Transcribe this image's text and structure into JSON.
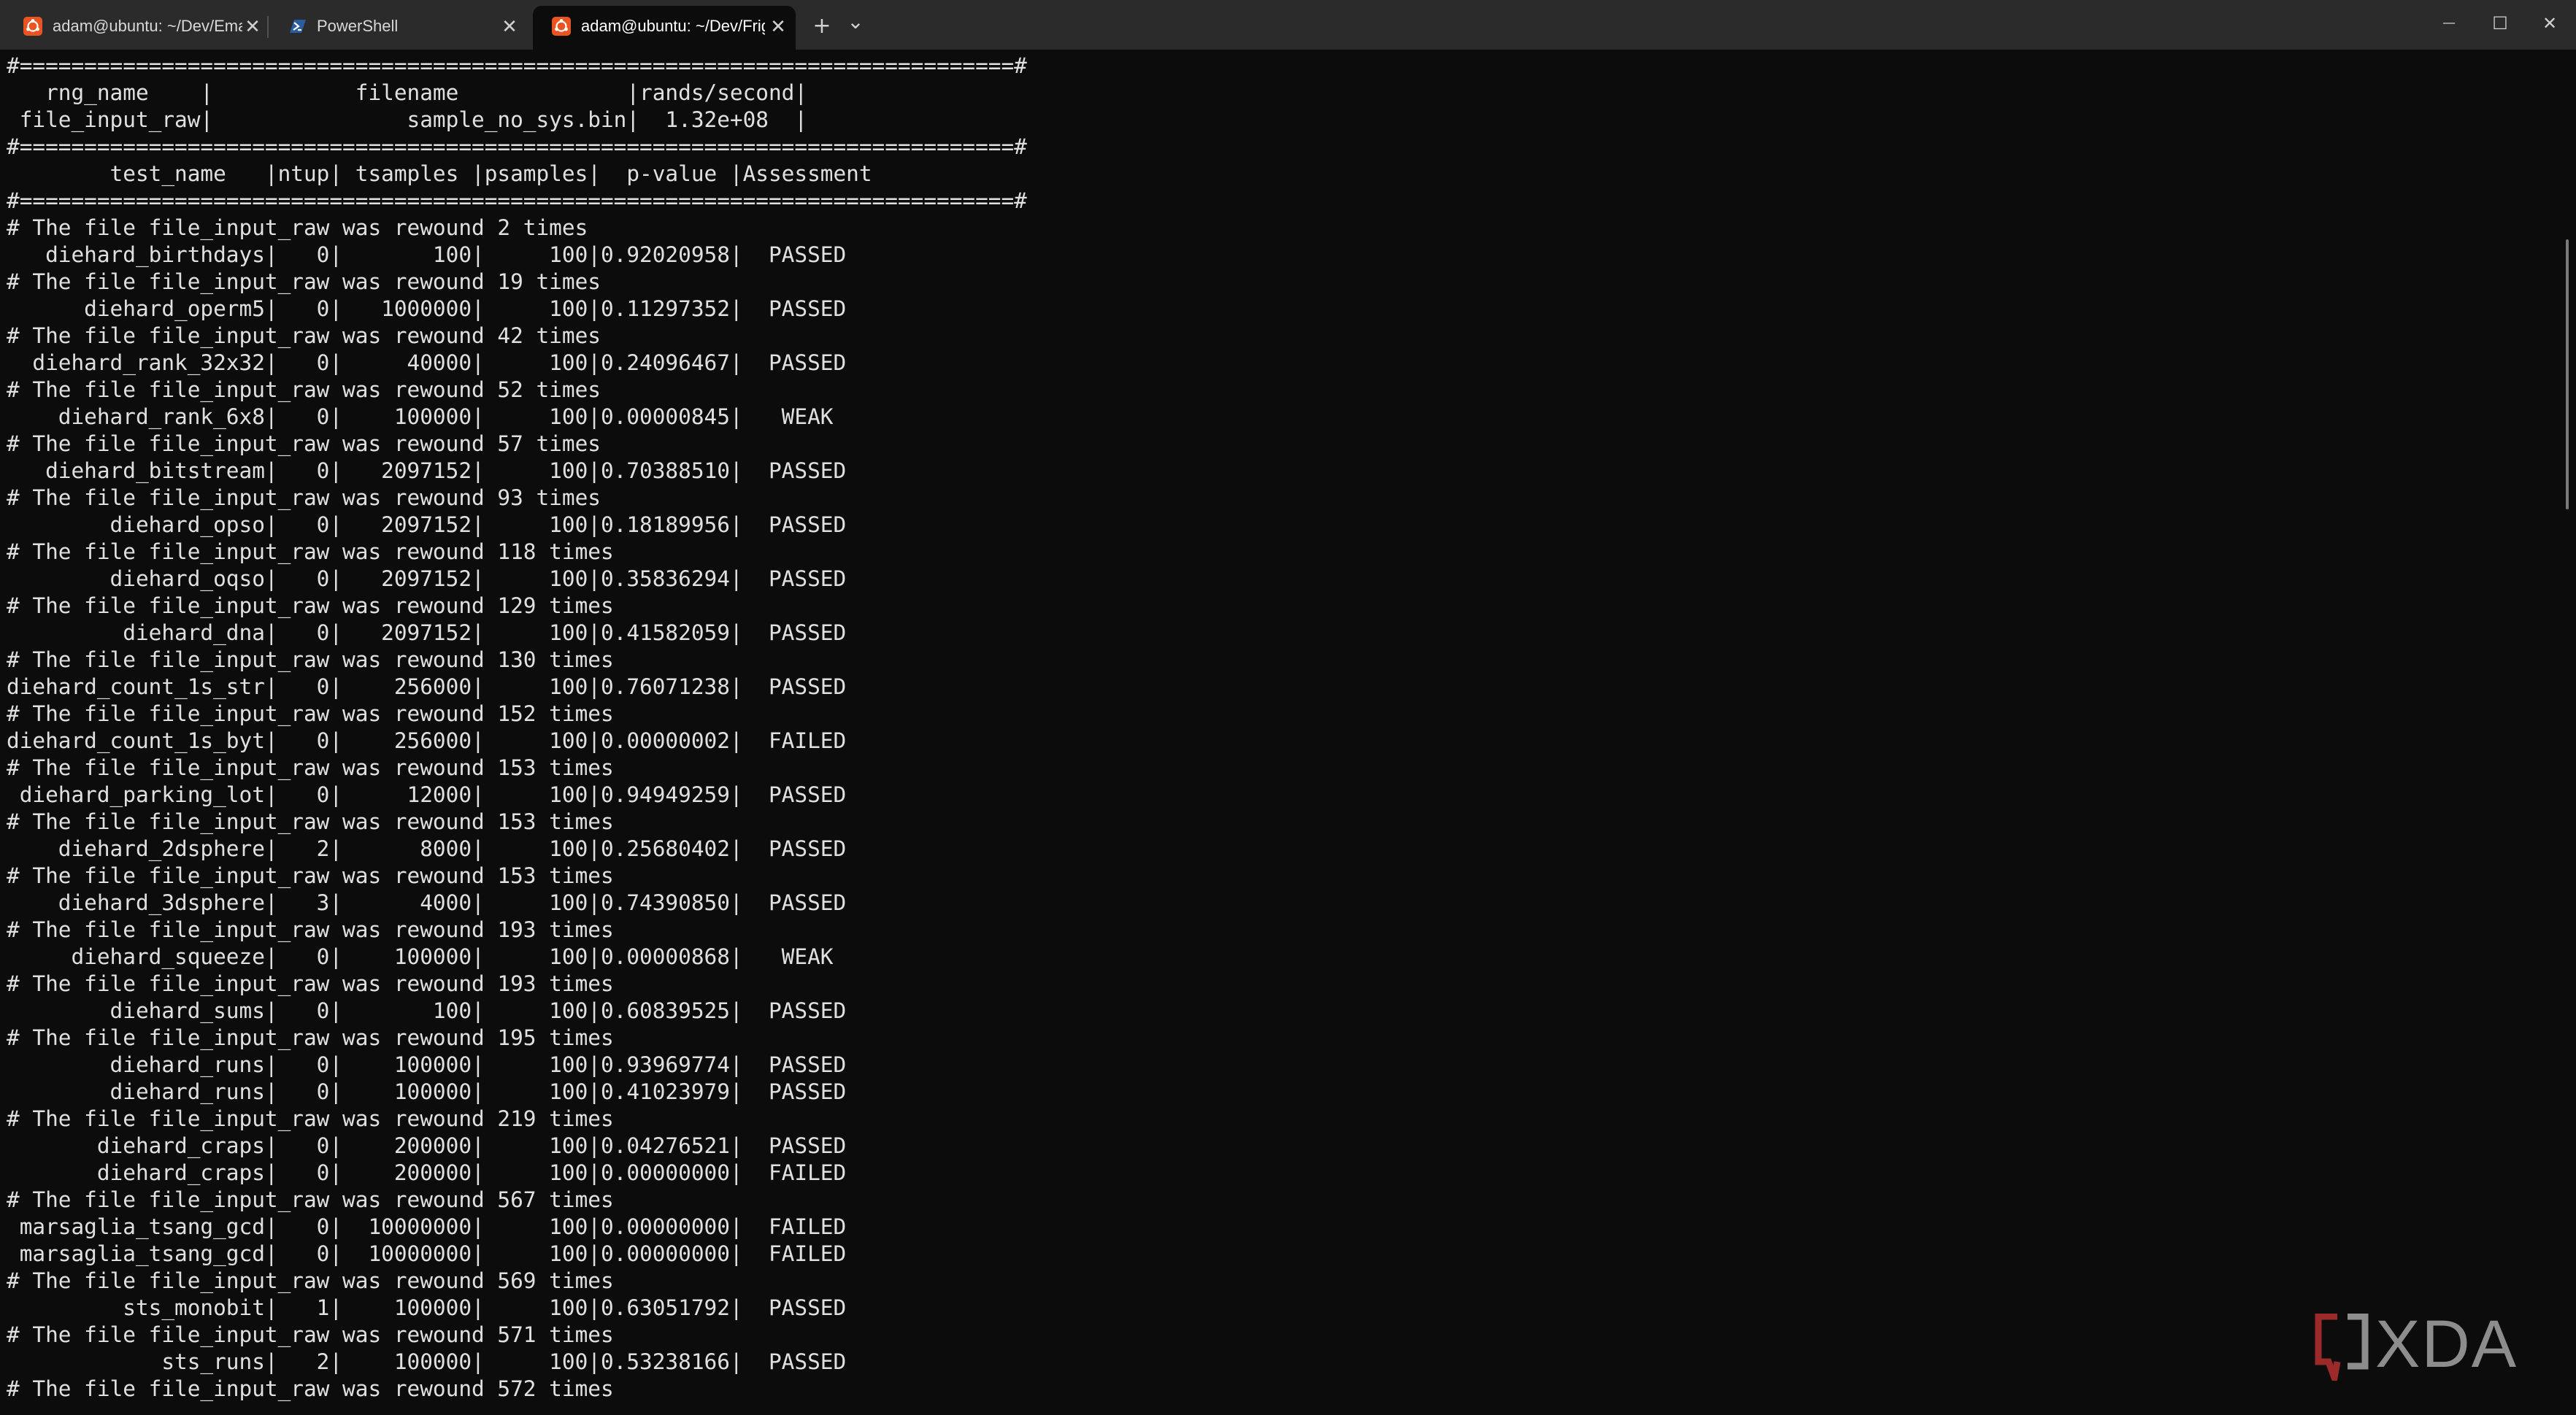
{
  "tabs": [
    {
      "title": "adam@ubuntu: ~/Dev/EmakiS",
      "icon": "ubuntu-icon",
      "active": false
    },
    {
      "title": "PowerShell",
      "icon": "powershell-icon",
      "active": false
    },
    {
      "title": "adam@ubuntu: ~/Dev/Frigat",
      "icon": "ubuntu-icon",
      "active": true
    }
  ],
  "tabbar": {
    "close_glyph": "✕",
    "new_tab_glyph": "+",
    "dropdown_glyph": "⌄"
  },
  "window_controls": {
    "minimize_glyph": "—",
    "maximize_glyph": "☐",
    "close_glyph": "✕"
  },
  "colors": {
    "titlebar_bg": "#2b2b2b",
    "terminal_bg": "#0c0c0c",
    "terminal_fg": "#e0e0e0",
    "ubuntu_orange": "#e95420",
    "watermark": "#8d8d8d",
    "watermark_accent": "#9c2a2a"
  },
  "terminal": {
    "lines": [
      "#=============================================================================#",
      "   rng_name    |           filename             |rands/second|",
      " file_input_raw|               sample_no_sys.bin|  1.32e+08  |",
      "#=============================================================================#",
      "        test_name   |ntup| tsamples |psamples|  p-value |Assessment",
      "#=============================================================================#",
      "# The file file_input_raw was rewound 2 times",
      "   diehard_birthdays|   0|       100|     100|0.92020958|  PASSED",
      "# The file file_input_raw was rewound 19 times",
      "      diehard_operm5|   0|   1000000|     100|0.11297352|  PASSED",
      "# The file file_input_raw was rewound 42 times",
      "  diehard_rank_32x32|   0|     40000|     100|0.24096467|  PASSED",
      "# The file file_input_raw was rewound 52 times",
      "    diehard_rank_6x8|   0|    100000|     100|0.00000845|   WEAK",
      "# The file file_input_raw was rewound 57 times",
      "   diehard_bitstream|   0|   2097152|     100|0.70388510|  PASSED",
      "# The file file_input_raw was rewound 93 times",
      "        diehard_opso|   0|   2097152|     100|0.18189956|  PASSED",
      "# The file file_input_raw was rewound 118 times",
      "        diehard_oqso|   0|   2097152|     100|0.35836294|  PASSED",
      "# The file file_input_raw was rewound 129 times",
      "         diehard_dna|   0|   2097152|     100|0.41582059|  PASSED",
      "# The file file_input_raw was rewound 130 times",
      "diehard_count_1s_str|   0|    256000|     100|0.76071238|  PASSED",
      "# The file file_input_raw was rewound 152 times",
      "diehard_count_1s_byt|   0|    256000|     100|0.00000002|  FAILED",
      "# The file file_input_raw was rewound 153 times",
      " diehard_parking_lot|   0|     12000|     100|0.94949259|  PASSED",
      "# The file file_input_raw was rewound 153 times",
      "    diehard_2dsphere|   2|      8000|     100|0.25680402|  PASSED",
      "# The file file_input_raw was rewound 153 times",
      "    diehard_3dsphere|   3|      4000|     100|0.74390850|  PASSED",
      "# The file file_input_raw was rewound 193 times",
      "     diehard_squeeze|   0|    100000|     100|0.00000868|   WEAK",
      "# The file file_input_raw was rewound 193 times",
      "        diehard_sums|   0|       100|     100|0.60839525|  PASSED",
      "# The file file_input_raw was rewound 195 times",
      "        diehard_runs|   0|    100000|     100|0.93969774|  PASSED",
      "        diehard_runs|   0|    100000|     100|0.41023979|  PASSED",
      "# The file file_input_raw was rewound 219 times",
      "       diehard_craps|   0|    200000|     100|0.04276521|  PASSED",
      "       diehard_craps|   0|    200000|     100|0.00000000|  FAILED",
      "# The file file_input_raw was rewound 567 times",
      " marsaglia_tsang_gcd|   0|  10000000|     100|0.00000000|  FAILED",
      " marsaglia_tsang_gcd|   0|  10000000|     100|0.00000000|  FAILED",
      "# The file file_input_raw was rewound 569 times",
      "         sts_monobit|   1|    100000|     100|0.63051792|  PASSED",
      "# The file file_input_raw was rewound 571 times",
      "            sts_runs|   2|    100000|     100|0.53238166|  PASSED",
      "# The file file_input_raw was rewound 572 times"
    ]
  },
  "watermark": {
    "text": "XDA"
  }
}
